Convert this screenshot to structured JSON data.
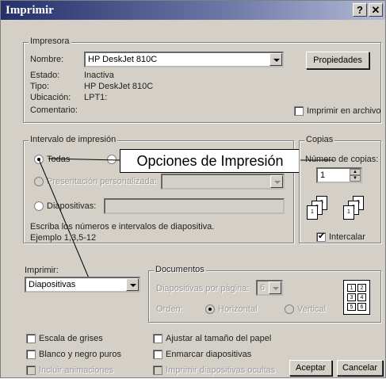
{
  "window": {
    "title": "Imprimir",
    "help_glyph": "?",
    "close_glyph": "✕"
  },
  "printer": {
    "legend": "Impresora",
    "name_label": "Nombre:",
    "name_value": "HP DeskJet 810C",
    "properties_button": "Propiedades",
    "status_label": "Estado:",
    "status_value": "Inactiva",
    "type_label": "Tipo:",
    "type_value": "HP DeskJet 810C",
    "where_label": "Ubicación:",
    "where_value": "LPT1:",
    "comment_label": "Comentario:",
    "print_to_file": "Imprimir en archivo"
  },
  "range": {
    "legend": "Intervalo de impresión",
    "all": "Todas",
    "custom_show": "Presentación personalizada:",
    "slides": "Diapositivas:",
    "hint": "Escriba los números e intervalos de diapositiva. Ejemplo 1,3,5-12"
  },
  "callout": {
    "text": "Opciones de Impresión"
  },
  "copies": {
    "legend": "Copias",
    "count_label": "Número de copias:",
    "count_value": "1",
    "collate": "Intercalar"
  },
  "print_what": {
    "label": "Imprimir:",
    "value": "Diapositivas"
  },
  "handouts": {
    "legend": "Documentos",
    "per_page_label": "Diapositivas por página:",
    "per_page_value": "6",
    "order_label": "Orden:",
    "horizontal": "Horizontal",
    "vertical": "Vertical"
  },
  "options": {
    "grayscale": "Escala de grises",
    "pure_bw": "Blanco y negro puros",
    "include_anim": "Incluir animaciones",
    "scale_to_fit": "Ajustar al tamaño del papel",
    "frame_slides": "Enmarcar diapositivas",
    "print_hidden": "Imprimir diapositivas ocultas"
  },
  "buttons": {
    "ok": "Aceptar",
    "cancel": "Cancelar"
  },
  "colors": {
    "face": "#d4d0c8",
    "title_start": "#24306a",
    "title_end": "#b3bad6"
  }
}
